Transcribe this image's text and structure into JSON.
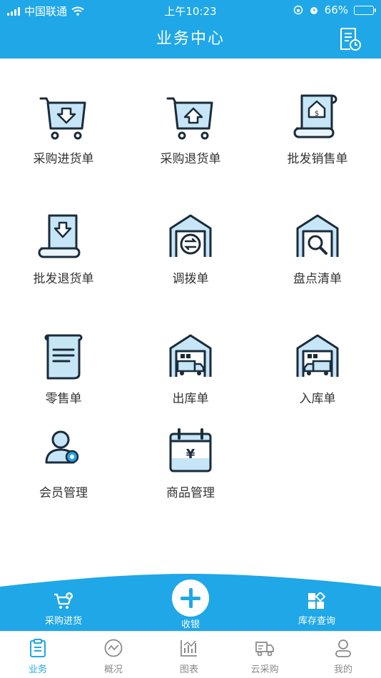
{
  "status": {
    "carrier": "中国联通",
    "time": "上午10:23",
    "battery": "66%",
    "battery_level": 0.66
  },
  "header": {
    "title": "业务中心"
  },
  "grid": [
    {
      "label": "采购进货单",
      "icon": "cart-in-icon"
    },
    {
      "label": "采购退货单",
      "icon": "cart-out-icon"
    },
    {
      "label": "批发销售单",
      "icon": "scroll-dollar-icon"
    },
    {
      "label": "批发退货单",
      "icon": "scroll-return-icon"
    },
    {
      "label": "调拨单",
      "icon": "warehouse-transfer-icon"
    },
    {
      "label": "盘点清单",
      "icon": "warehouse-search-icon"
    },
    {
      "label": "零售单",
      "icon": "document-icon"
    },
    {
      "label": "出库单",
      "icon": "warehouse-truck-out-icon"
    },
    {
      "label": "入库单",
      "icon": "warehouse-truck-in-icon"
    },
    {
      "label": "会员管理",
      "icon": "member-icon"
    },
    {
      "label": "商品管理",
      "icon": "calendar-yuan-icon"
    }
  ],
  "actions": {
    "purchase": "采购进货",
    "cashier": "收银",
    "inventory": "库存查询"
  },
  "tabs": [
    {
      "label": "业务",
      "icon": "clipboard-icon",
      "active": true
    },
    {
      "label": "概况",
      "icon": "trend-icon"
    },
    {
      "label": "图表",
      "icon": "bar-chart-icon"
    },
    {
      "label": "云采购",
      "icon": "truck-icon"
    },
    {
      "label": "我的",
      "icon": "person-icon"
    }
  ],
  "colors": {
    "primary": "#1fa7e8",
    "icon_dark": "#1b2b3a",
    "icon_fill": "#c6e6f7"
  }
}
